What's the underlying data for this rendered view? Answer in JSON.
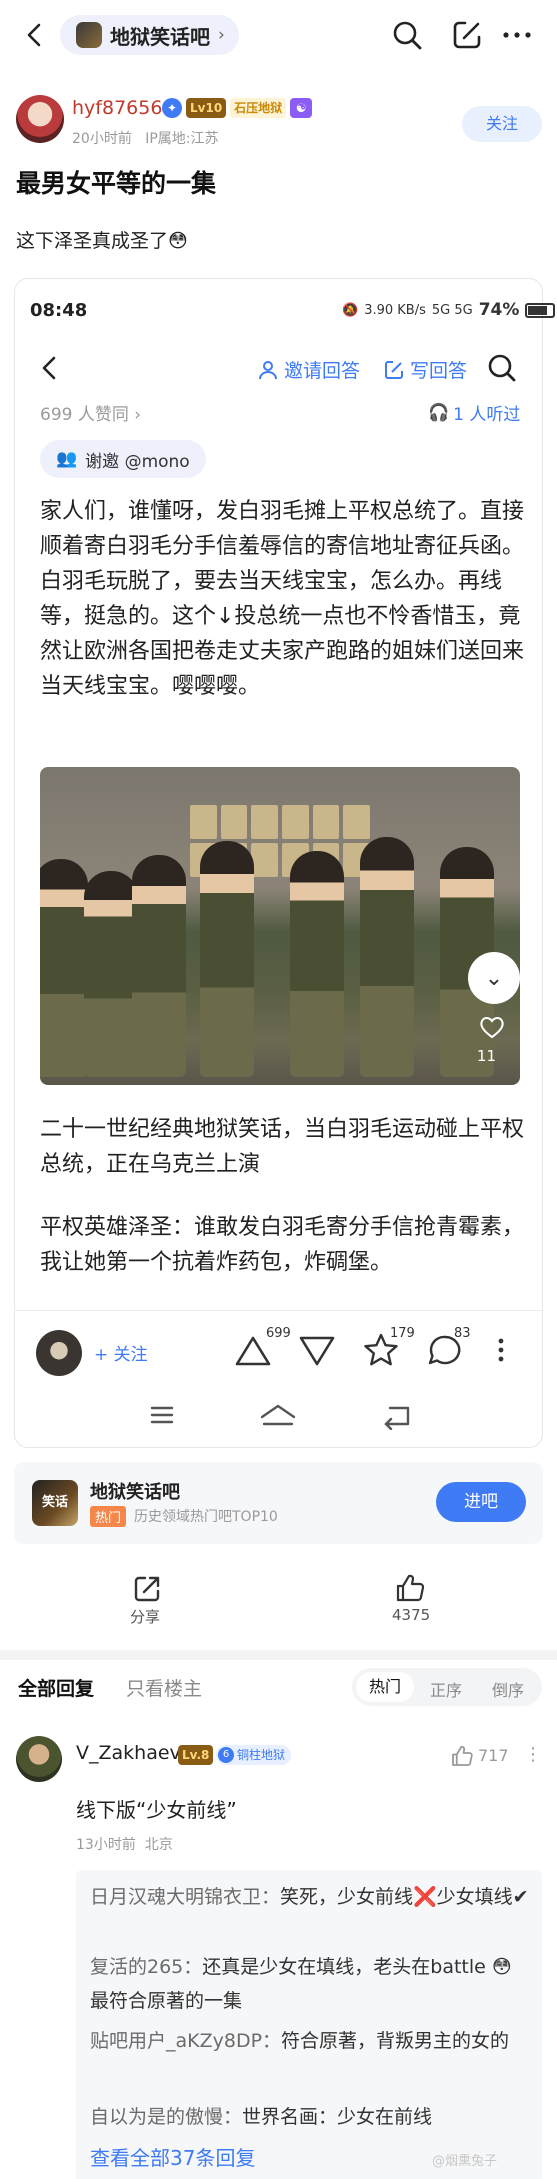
{
  "nav": {
    "forum_name": "地狱笑话吧",
    "chevron": "›"
  },
  "author": {
    "name": "hyf87656",
    "level": "Lv10",
    "title_badge": "石压地狱",
    "time": "20小时前",
    "location": "IP属地:江苏",
    "follow_label": "关注"
  },
  "post": {
    "title": "最男女平等的一集",
    "body": "这下泽圣真成圣了😳"
  },
  "screenshot": {
    "time": "08:48",
    "net_speed": "3.90 KB/s",
    "signal": "5G 5G",
    "battery": "74%",
    "invite_label": "邀请回答",
    "write_label": "写回答",
    "agree_count": "699 人赞同 ›",
    "listened": "1 人听过",
    "thanks": "谢邀 @mono",
    "answer": "家人们，谁懂呀，发白羽毛摊上平权总统了。直接顺着寄白羽毛分手信羞辱信的寄信地址寄征兵函。白羽毛玩脱了，要去当天线宝宝，怎么办。再线等，挺急的。这个↓投总统一点也不怜香惜玉，竟然让欧洲各国把卷走丈夫家产跑路的姐妹们送回来当天线宝宝。嘤嘤嘤。",
    "photo_like_count": "11",
    "para2": "二十一世纪经典地狱笑话，当白羽毛运动碰上平权总统，正在乌克兰上演",
    "para3": "平权英雄泽圣：谁敢发白羽毛寄分手信抢青霉素，我让她第一个抗着炸药包，炸碉堡。",
    "follow_label": "+ 关注",
    "upvotes": "699",
    "favorites": "179",
    "comments": "83"
  },
  "forum_card": {
    "logo_text": "笑话",
    "name": "地狱笑话吧",
    "hot_tag": "热门",
    "desc": "历史领域热门吧TOP10",
    "enter_label": "进吧"
  },
  "actions": {
    "share_label": "分享",
    "like_count": "4375"
  },
  "tabs": {
    "all": "全部回复",
    "host_only": "只看楼主",
    "sort_hot": "热门",
    "sort_asc": "正序",
    "sort_desc": "倒序"
  },
  "comment": {
    "name": "V_Zakhaev",
    "level": "Lv.8",
    "tag_num": "6",
    "tag": "铜柱地狱",
    "likes": "717",
    "more": "⋮",
    "text": "线下版“少女前线”",
    "time": "13小时前",
    "location": "北京",
    "replies": [
      {
        "who": "日月汉魂大明锦衣卫：",
        "text": "笑死，少女前线❌少女填线✔"
      },
      {
        "who": "复活的265：",
        "text": "还真是少女在填线，老头在battle 😳最符合原著的一集"
      },
      {
        "who": "贴吧用户_aKZy8DP：",
        "text": "符合原著，背叛男主的女的"
      },
      {
        "who": "自以为是的傲慢：",
        "text": "世界名画：少女在前线"
      }
    ],
    "view_all": "查看全部37条回复"
  },
  "watermark": "@烟熏兔子",
  "colors": {
    "accent": "#3f7bf5",
    "username": "#c0392b",
    "hot_tag": "#f5874a"
  }
}
